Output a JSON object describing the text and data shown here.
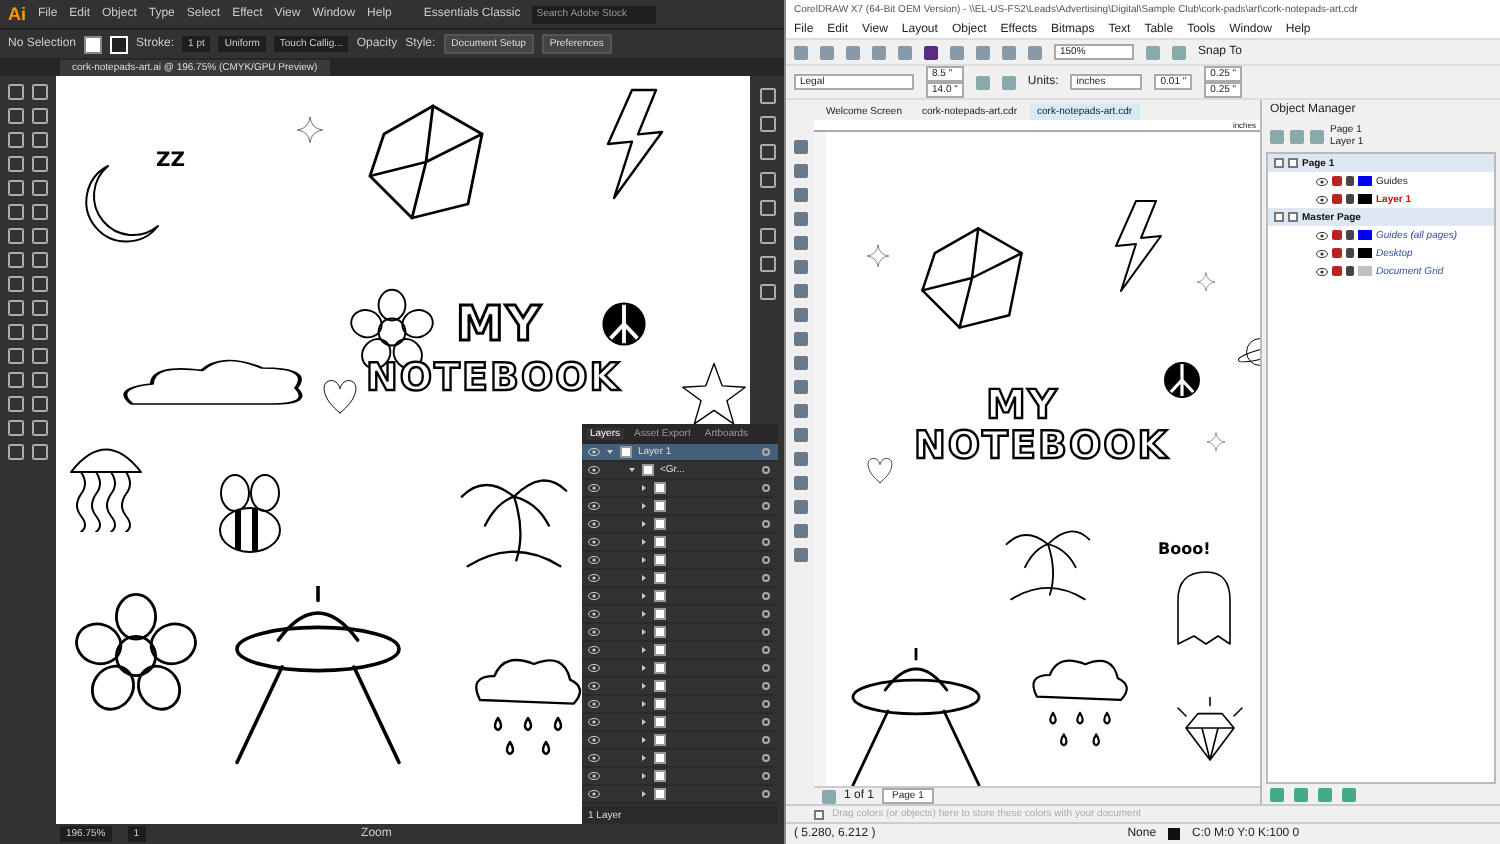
{
  "illustrator": {
    "logo": "Ai",
    "menu": [
      "File",
      "Edit",
      "Object",
      "Type",
      "Select",
      "Effect",
      "View",
      "Window",
      "Help"
    ],
    "workspace": "Essentials Classic",
    "search_placeholder": "Search Adobe Stock",
    "control_bar": {
      "selection": "No Selection",
      "stroke_label": "Stroke:",
      "stroke_value": "1 pt",
      "profile": "Uniform",
      "brush": "Touch Callig...",
      "opacity_label": "Opacity",
      "style_label": "Style:",
      "buttons": [
        "Document Setup",
        "Preferences"
      ]
    },
    "document_tab": "cork-notepads-art.ai @ 196.75% (CMYK/GPU Preview)",
    "artwork_texts": {
      "snore": "ZZ",
      "title_top": "MY",
      "title_bottom": "NOTEBOOK"
    },
    "layers_panel": {
      "tabs": [
        {
          "label": "Layers",
          "selected": true
        },
        {
          "label": "Asset Export",
          "selected": false
        },
        {
          "label": "Artboards",
          "selected": false
        }
      ],
      "layer": {
        "name": "Layer 1",
        "expanded": true
      },
      "group": {
        "name": "<Gr...",
        "expanded": true
      },
      "items": [
        {
          "visible": true
        },
        {
          "visible": true
        },
        {
          "visible": true
        },
        {
          "visible": true
        },
        {
          "visible": true
        },
        {
          "visible": true
        },
        {
          "visible": true
        },
        {
          "visible": true
        },
        {
          "visible": true
        },
        {
          "visible": true
        },
        {
          "visible": true
        },
        {
          "visible": true
        },
        {
          "visible": true
        },
        {
          "visible": true
        },
        {
          "visible": true
        },
        {
          "visible": true
        },
        {
          "visible": true
        },
        {
          "visible": true
        }
      ],
      "footer": "1 Layer"
    },
    "status": {
      "zoom": "196.75%",
      "artboard": "1",
      "tool": "Zoom"
    }
  },
  "coreldraw": {
    "title": "CorelDRAW X7 (64-Bit OEM Version) - \\\\EL-US-FS2\\Leads\\Advertising\\Digital\\Sample Club\\cork-pads\\art\\cork-notepads-art.cdr",
    "menu": [
      "File",
      "Edit",
      "View",
      "Layout",
      "Object",
      "Effects",
      "Bitmaps",
      "Text",
      "Table",
      "Tools",
      "Window",
      "Help"
    ],
    "zoom": "150%",
    "snap": "Snap To",
    "property_bar": {
      "page_size": "Legal",
      "width": "8.5 \"",
      "height": "14.0 \"",
      "units_label": "Units:",
      "units": "inches",
      "nudge": "0.01 \"",
      "dup_x": "0.25 \"",
      "dup_y": "0.25 \""
    },
    "tabs": [
      {
        "label": "Welcome Screen",
        "selected": false
      },
      {
        "label": "cork-notepads-art.cdr",
        "selected": false
      },
      {
        "label": "cork-notepads-art.cdr",
        "selected": true
      }
    ],
    "ruler_unit": "inches",
    "artwork_texts": {
      "title_top": "MY",
      "title_bottom": "NOTEBOOK",
      "ghost": "Booo!"
    },
    "object_manager": {
      "title": "Object Manager",
      "current_page": "Page 1",
      "current_layer": "Layer 1",
      "tree": [
        {
          "label": "Page 1",
          "expanded": true,
          "children": [
            {
              "label": "Guides",
              "color": "#0000ff",
              "active": false
            },
            {
              "label": "Layer 1",
              "color": "#000000",
              "active": true
            }
          ]
        },
        {
          "label": "Master Page",
          "expanded": true,
          "children": [
            {
              "label": "Guides (all pages)",
              "color": "#0000ff",
              "active": false
            },
            {
              "label": "Desktop",
              "color": "#000000",
              "active": false
            },
            {
              "label": "Document Grid",
              "color": "#c0c0c0",
              "active": false
            }
          ]
        }
      ]
    },
    "page_nav": {
      "count": "1 of 1",
      "page_tab": "Page 1"
    },
    "palette_hint": "Drag colors (or objects) here to store these colors with your document",
    "status": {
      "coordinates": "( 5.280, 6.212 )",
      "fill": "None",
      "outline": "C:0 M:0 Y:0 K:100 0"
    }
  }
}
